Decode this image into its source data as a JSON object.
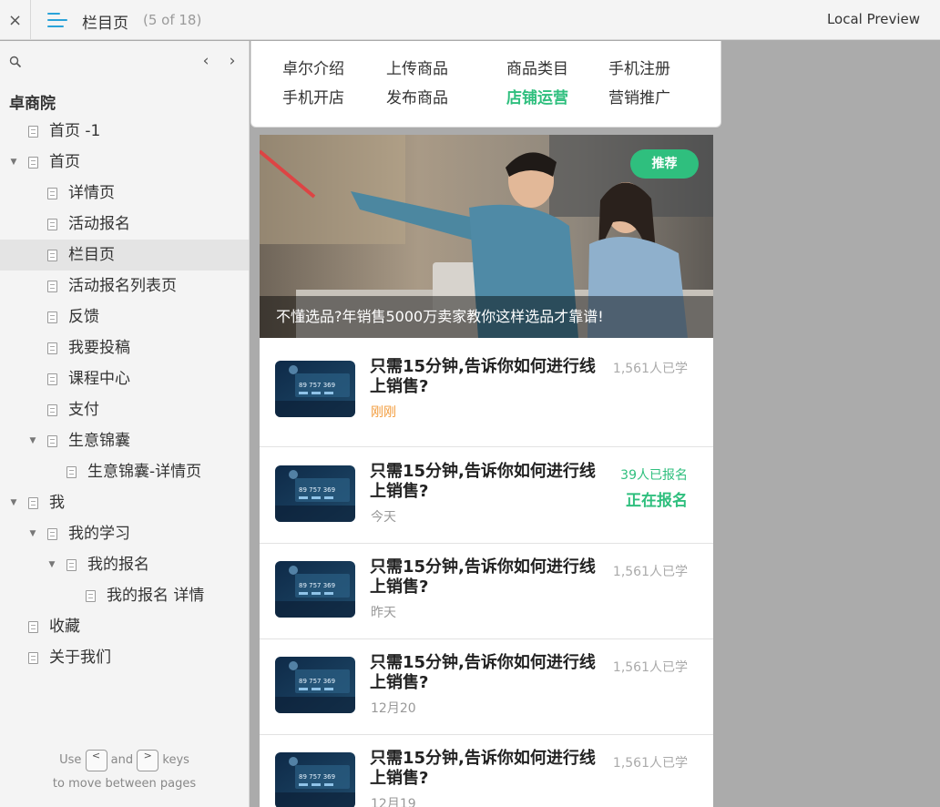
{
  "topbar": {
    "close_label": "×",
    "title": "栏目页",
    "count": "(5 of 18)",
    "right_label": "Local Preview"
  },
  "sidebar": {
    "site_title": "卓商院",
    "prev_label": "‹",
    "next_label": "›",
    "items": [
      {
        "label": "首页 -1",
        "level": 1,
        "expanded": null
      },
      {
        "label": "首页",
        "level": 1,
        "expanded": true
      },
      {
        "label": "详情页",
        "level": 2,
        "expanded": null
      },
      {
        "label": "活动报名",
        "level": 2,
        "expanded": null
      },
      {
        "label": "栏目页",
        "level": 2,
        "expanded": null,
        "active": true
      },
      {
        "label": "活动报名列表页",
        "level": 2,
        "expanded": null
      },
      {
        "label": "反馈",
        "level": 2,
        "expanded": null
      },
      {
        "label": "我要投稿",
        "level": 2,
        "expanded": null
      },
      {
        "label": "课程中心",
        "level": 2,
        "expanded": null
      },
      {
        "label": "支付",
        "level": 2,
        "expanded": null
      },
      {
        "label": "生意锦囊",
        "level": 2,
        "expanded": true
      },
      {
        "label": "生意锦囊-详情页",
        "level": 3,
        "expanded": null
      },
      {
        "label": "我",
        "level": 1,
        "expanded": true
      },
      {
        "label": "我的学习",
        "level": 2,
        "expanded": true
      },
      {
        "label": "我的报名",
        "level": 3,
        "expanded": true
      },
      {
        "label": "我的报名 详情",
        "level": 4,
        "expanded": null
      },
      {
        "label": "收藏",
        "level": 1,
        "expanded": null
      },
      {
        "label": "关于我们",
        "level": 1,
        "expanded": null
      }
    ],
    "hint": {
      "use": "Use",
      "and": "and",
      "keys": "keys",
      "line2": "to move between pages",
      "key_prev": "<",
      "key_next": ">"
    }
  },
  "tabs": [
    {
      "label": "卓尔介绍",
      "active": false
    },
    {
      "label": "上传商品",
      "active": false
    },
    {
      "label": "商品类目",
      "active": false
    },
    {
      "label": "手机注册",
      "active": false
    },
    {
      "label": "手机开店",
      "active": false
    },
    {
      "label": "发布商品",
      "active": false
    },
    {
      "label": "店铺运营",
      "active": true
    },
    {
      "label": "营销推广",
      "active": false
    }
  ],
  "hero": {
    "badge": "推荐",
    "caption": "不懂选品?年销售5000万卖家教你这样选品才靠谱!"
  },
  "thumb_text": "89 757 369",
  "items": [
    {
      "title": "只需15分钟,告诉你如何进行线上销售?",
      "meta": "刚刚",
      "meta_color": "orange",
      "count": "1,561人已学",
      "status": ""
    },
    {
      "title": "只需15分钟,告诉你如何进行线上销售?",
      "meta": "今天",
      "meta_color": "gray",
      "count": "39人已报名",
      "status": "正在报名"
    },
    {
      "title": "只需15分钟,告诉你如何进行线上销售?",
      "meta": "昨天",
      "meta_color": "gray",
      "count": "1,561人已学",
      "status": ""
    },
    {
      "title": "只需15分钟,告诉你如何进行线上销售?",
      "meta": "12月20",
      "meta_color": "gray",
      "count": "1,561人已学",
      "status": ""
    },
    {
      "title": "只需15分钟,告诉你如何进行线上销售?",
      "meta": "12月19",
      "meta_color": "gray",
      "count": "1,561人已学",
      "status": ""
    }
  ],
  "colors": {
    "accent_green": "#2fbf7e",
    "accent_orange": "#f29b3b",
    "menu_blue": "#2aa3d9"
  }
}
